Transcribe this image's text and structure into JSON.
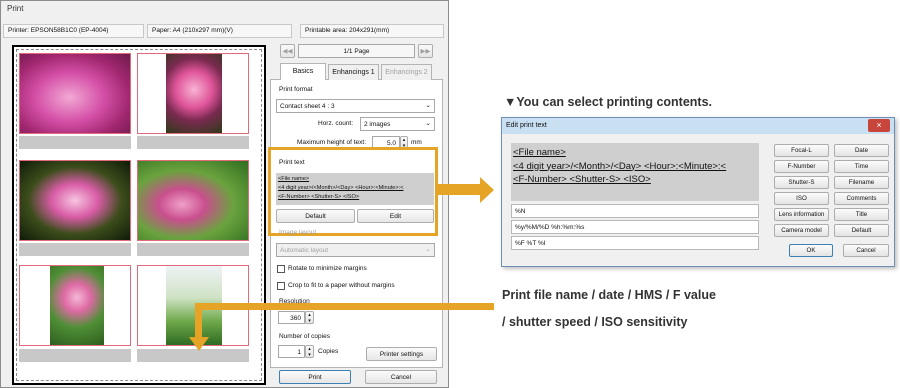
{
  "print_dialog": {
    "title": "Print",
    "printer_info": "Printer: EPSON58B1C0 (EP-4004)",
    "paper_info": "Paper: A4 (210x297 mm)(V)",
    "printable_area": "Printable area: 204x291(mm)",
    "page_indicator": "1/1 Page",
    "tabs": [
      "Basics",
      "Enhancings 1",
      "Enhancings 2"
    ],
    "print_format": {
      "label": "Print format",
      "value": "Contact sheet  4 : 3",
      "horz_count_label": "Horz. count:",
      "horz_count_value": "2 images",
      "max_height_label": "Maximum height of text:",
      "max_height_value": "5.0",
      "max_height_unit": "mm"
    },
    "print_text": {
      "label": "Print text",
      "lines": [
        "<File name>",
        "<4 digit year>/<Month>/<Day> <Hour>:<Minute>:<",
        "<F-Number> <Shutter-S> <ISO>"
      ],
      "default_button": "Default",
      "edit_button": "Edit"
    },
    "image_layout": {
      "label": "Image layout",
      "value": "Automatic layout"
    },
    "options": [
      "Rotate to minimize margins",
      "Crop to fit to a paper without margins"
    ],
    "resolution": {
      "label": "Resolution",
      "value": "360"
    },
    "copies": {
      "label": "Number of copies",
      "value": "1",
      "unit": "Copies"
    },
    "printer_settings_button": "Printer settings",
    "print_button": "Print",
    "cancel_button": "Cancel"
  },
  "edit_print_text_dialog": {
    "title": "Edit print text",
    "close_symbol": "×",
    "preview_lines": [
      "<File name>",
      "<4 digit year>/<Month>/<Day> <Hour>:<Minute>:<",
      "<F-Number> <Shutter-S> <ISO>"
    ],
    "format_fields": [
      "%N",
      "%y/%M/%D %h:%m:%s",
      "%F %T %I"
    ],
    "left_buttons": [
      "Focal-L",
      "F-Number",
      "Shutter-S",
      "ISO",
      "Lens information",
      "Camera model"
    ],
    "right_buttons": [
      "Date",
      "Time",
      "Filename",
      "Comments",
      "Title",
      "Default"
    ],
    "ok_button": "OK",
    "cancel_button": "Cancel"
  },
  "annotations": {
    "select_contents": "▼You can select printing contents.",
    "print_info_line1": "Print file name / date / HMS / F value",
    "print_info_line2": "/ shutter speed / ISO sensitivity"
  },
  "colors": {
    "highlight": "#e5a425",
    "caption_bar": "#c8c8c8",
    "cell_border": "#e26a7a"
  }
}
